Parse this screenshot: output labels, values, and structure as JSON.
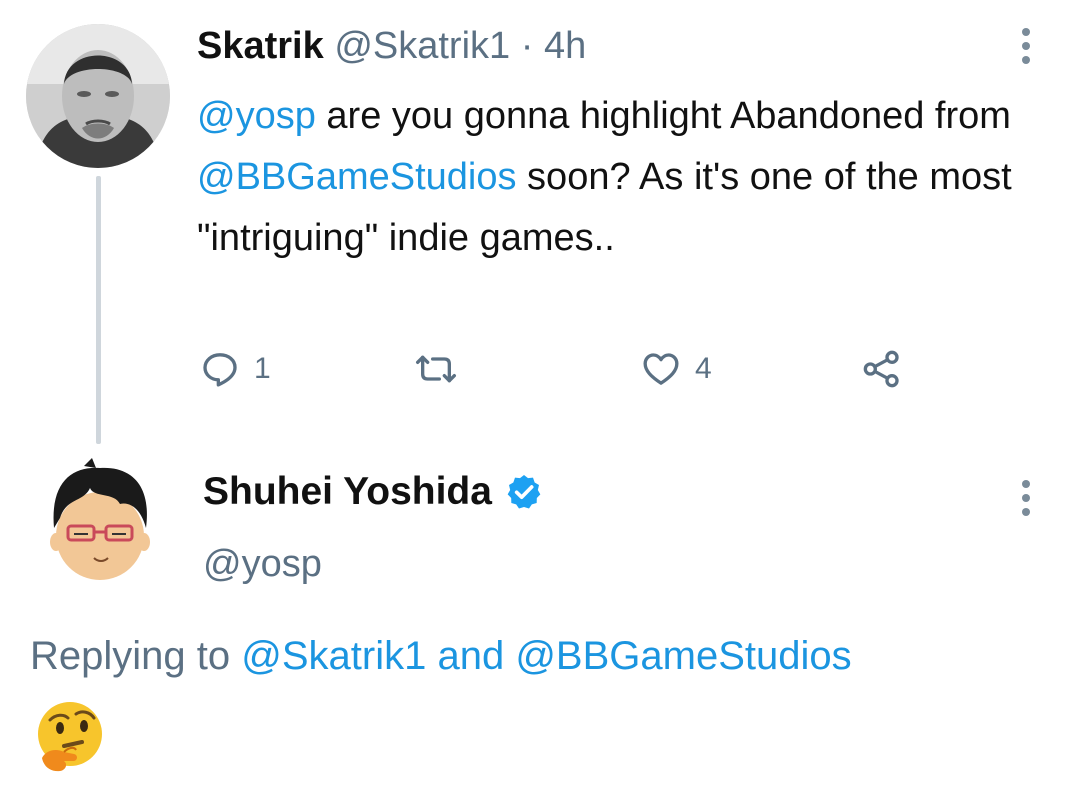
{
  "tweet1": {
    "name": "Skatrik",
    "handle": "@Skatrik1",
    "separator": "·",
    "time": "4h",
    "body": {
      "mention1": "@yosp",
      "text1": " are you gonna highlight Abandoned from ",
      "mention2": "@BBGameStudios",
      "text2": " soon? As it's one of the most \"intriguing\" indie games.."
    },
    "actions": {
      "reply_count": "1",
      "like_count": "4",
      "reply_icon": "reply-icon",
      "retweet_icon": "retweet-icon",
      "like_icon": "heart-icon",
      "share_icon": "share-icon"
    }
  },
  "tweet2": {
    "name": "Shuhei Yoshida",
    "handle": "@yosp",
    "replying_prefix": "Replying to ",
    "replying_mention1": "@Skatrik1",
    "replying_and": " and ",
    "replying_mention2": "@BBGameStudios",
    "content_emoji": "thinking-face-emoji"
  },
  "colors": {
    "link": "#1b95e0",
    "muted": "#5b7083",
    "verified": "#1da1f2",
    "thread_line": "#cfd6dc"
  }
}
